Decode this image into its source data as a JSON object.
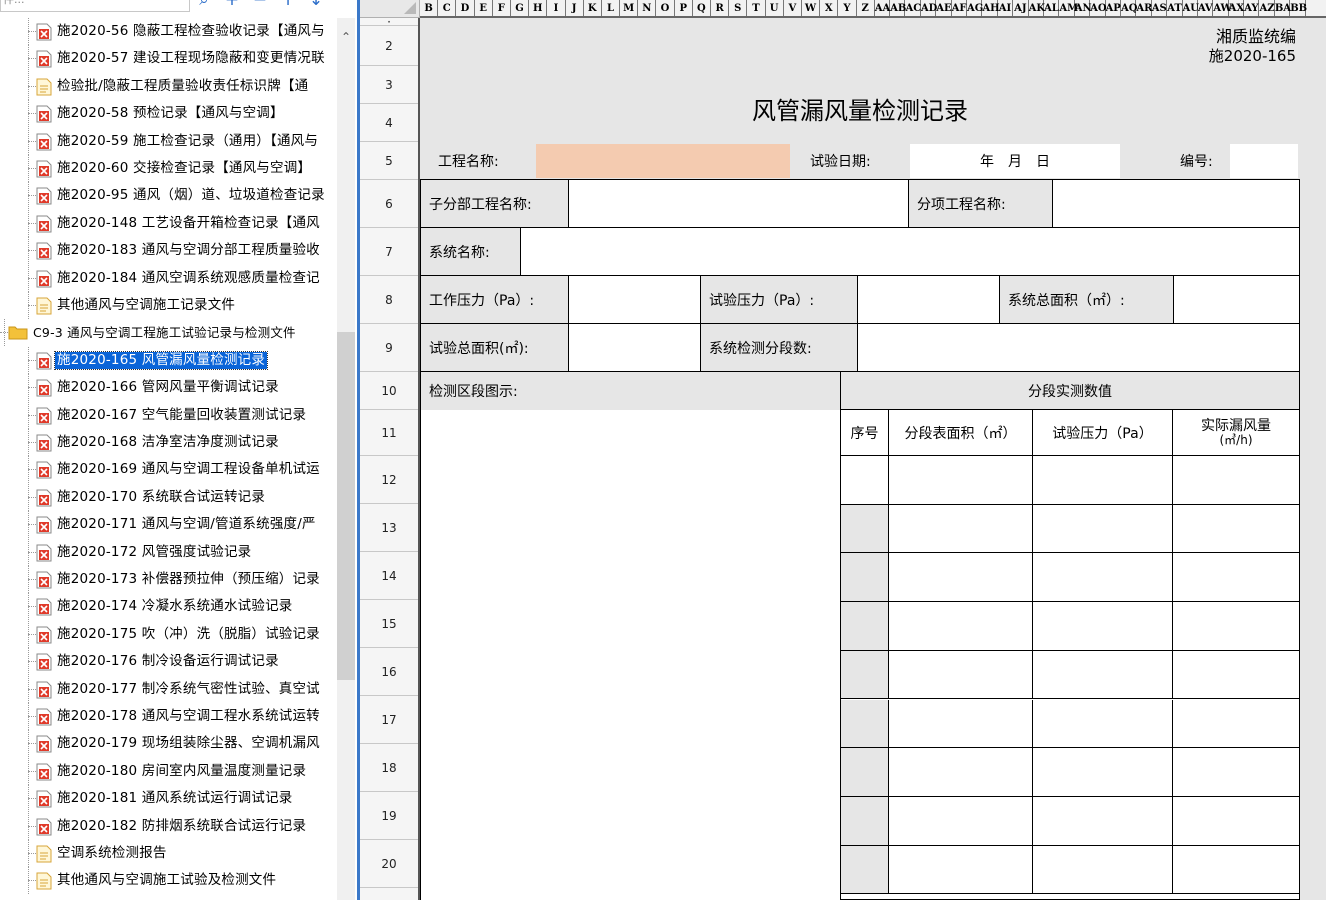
{
  "tree": {
    "search_placeholder": "件...",
    "toolbar_icons": [
      "search-icon",
      "plus-icon",
      "minus-icon",
      "arrow-up-icon",
      "arrow-down-icon"
    ],
    "items": [
      {
        "label": "施2020-56 隐蔽工程检查验收记录【通风与",
        "icon": "red-x-file-icon"
      },
      {
        "label": "施2020-57 建设工程现场隐蔽和变更情况联",
        "icon": "red-x-file-icon"
      },
      {
        "label": "检验批/隐蔽工程质量验收责任标识牌【通",
        "icon": "doc-file-icon"
      },
      {
        "label": "施2020-58 预检记录【通风与空调】",
        "icon": "red-x-file-icon"
      },
      {
        "label": "施2020-59 施工检查记录（通用）【通风与",
        "icon": "red-x-file-icon"
      },
      {
        "label": "施2020-60 交接检查记录【通风与空调】",
        "icon": "red-x-file-icon"
      },
      {
        "label": "施2020-95 通风（烟）道、垃圾道检查记录",
        "icon": "red-x-file-icon"
      },
      {
        "label": "施2020-148 工艺设备开箱检查记录【通风",
        "icon": "red-x-file-icon"
      },
      {
        "label": "施2020-183 通风与空调分部工程质量验收",
        "icon": "red-x-file-icon"
      },
      {
        "label": "施2020-184 通风空调系统观感质量检查记",
        "icon": "red-x-file-icon"
      },
      {
        "label": "其他通风与空调施工记录文件",
        "icon": "doc-file-icon"
      },
      {
        "label": "C9-3 通风与空调工程施工试验记录与检测文件",
        "icon": "folder-icon",
        "folder": true
      },
      {
        "label": "施2020-165 风管漏风量检测记录",
        "icon": "red-x-file-icon",
        "selected": true
      },
      {
        "label": "施2020-166 管网风量平衡调试记录",
        "icon": "red-x-file-icon"
      },
      {
        "label": "施2020-167 空气能量回收装置测试记录",
        "icon": "red-x-file-icon"
      },
      {
        "label": "施2020-168 洁净室洁净度测试记录",
        "icon": "red-x-file-icon"
      },
      {
        "label": "施2020-169 通风与空调工程设备单机试运",
        "icon": "red-x-file-icon"
      },
      {
        "label": "施2020-170 系统联合试运转记录",
        "icon": "red-x-file-icon"
      },
      {
        "label": "施2020-171 通风与空调/管道系统强度/严",
        "icon": "red-x-file-icon"
      },
      {
        "label": "施2020-172 风管强度试验记录",
        "icon": "red-x-file-icon"
      },
      {
        "label": "施2020-173 补偿器预拉伸（预压缩）记录",
        "icon": "red-x-file-icon"
      },
      {
        "label": "施2020-174 冷凝水系统通水试验记录",
        "icon": "red-x-file-icon"
      },
      {
        "label": "施2020-175 吹（冲）洗（脱脂）试验记录",
        "icon": "red-x-file-icon"
      },
      {
        "label": "施2020-176 制冷设备运行调试记录",
        "icon": "red-x-file-icon"
      },
      {
        "label": "施2020-177 制冷系统气密性试验、真空试",
        "icon": "red-x-file-icon"
      },
      {
        "label": "施2020-178 通风与空调工程水系统试运转",
        "icon": "red-x-file-icon"
      },
      {
        "label": "施2020-179 现场组装除尘器、空调机漏风",
        "icon": "red-x-file-icon"
      },
      {
        "label": "施2020-180 房间室内风量温度测量记录",
        "icon": "red-x-file-icon"
      },
      {
        "label": "施2020-181 通风系统试运行调试记录",
        "icon": "red-x-file-icon"
      },
      {
        "label": "施2020-182 防排烟系统联合试运行记录",
        "icon": "red-x-file-icon"
      },
      {
        "label": "空调系统检测报告",
        "icon": "doc-file-icon"
      },
      {
        "label": "其他通风与空调施工试验及检测文件",
        "icon": "doc-file-icon"
      }
    ]
  },
  "sheet": {
    "columns": [
      "B",
      "C",
      "D",
      "E",
      "F",
      "G",
      "H",
      "I",
      "J",
      "K",
      "L",
      "M",
      "N",
      "O",
      "P",
      "Q",
      "R",
      "S",
      "T",
      "U",
      "V",
      "W",
      "X",
      "Y",
      "Z",
      "AA",
      "AB",
      "AC",
      "AD",
      "AE",
      "AF",
      "AG",
      "AH",
      "AI",
      "AJ",
      "AK",
      "AL",
      "AM",
      "AN",
      "AO",
      "AP",
      "AQ",
      "AR",
      "AS",
      "AT",
      "AU",
      "AV",
      "AW",
      "AX",
      "AY",
      "AZ",
      "BA",
      "BB"
    ],
    "rows": [
      "·",
      "2",
      "3",
      "4",
      "5",
      "6",
      "7",
      "8",
      "9",
      "10",
      "11",
      "12",
      "13",
      "14",
      "15",
      "16",
      "17",
      "18",
      "19",
      "20"
    ],
    "form": {
      "org_line1": "湘质监统编",
      "org_line2": "施2020-165",
      "title": "风管漏风量检测记录",
      "project_name_label": "工程名称:",
      "project_name_value": "",
      "test_date_label": "试验日期:",
      "test_date_value": "年　月　日",
      "number_label": "编号:",
      "subdivision_label": "子分部工程名称:",
      "item_label": "分项工程名称:",
      "system_name_label": "系统名称:",
      "working_pressure_label": "工作压力（Pa）:",
      "test_pressure_label": "试验压力（Pa）:",
      "system_area_label": "系统总面积（㎡）:",
      "test_area_label": "试验总面积(㎡):",
      "segments_label": "系统检测分段数:",
      "diagram_label": "检测区段图示:",
      "measured_header": "分段实测数值",
      "col_index": "序号",
      "col_area": "分段表面积（㎡）",
      "col_pressure": "试验压力（Pa）",
      "col_leak_line1": "实际漏风量",
      "col_leak_line2": "(㎥/h)"
    }
  }
}
